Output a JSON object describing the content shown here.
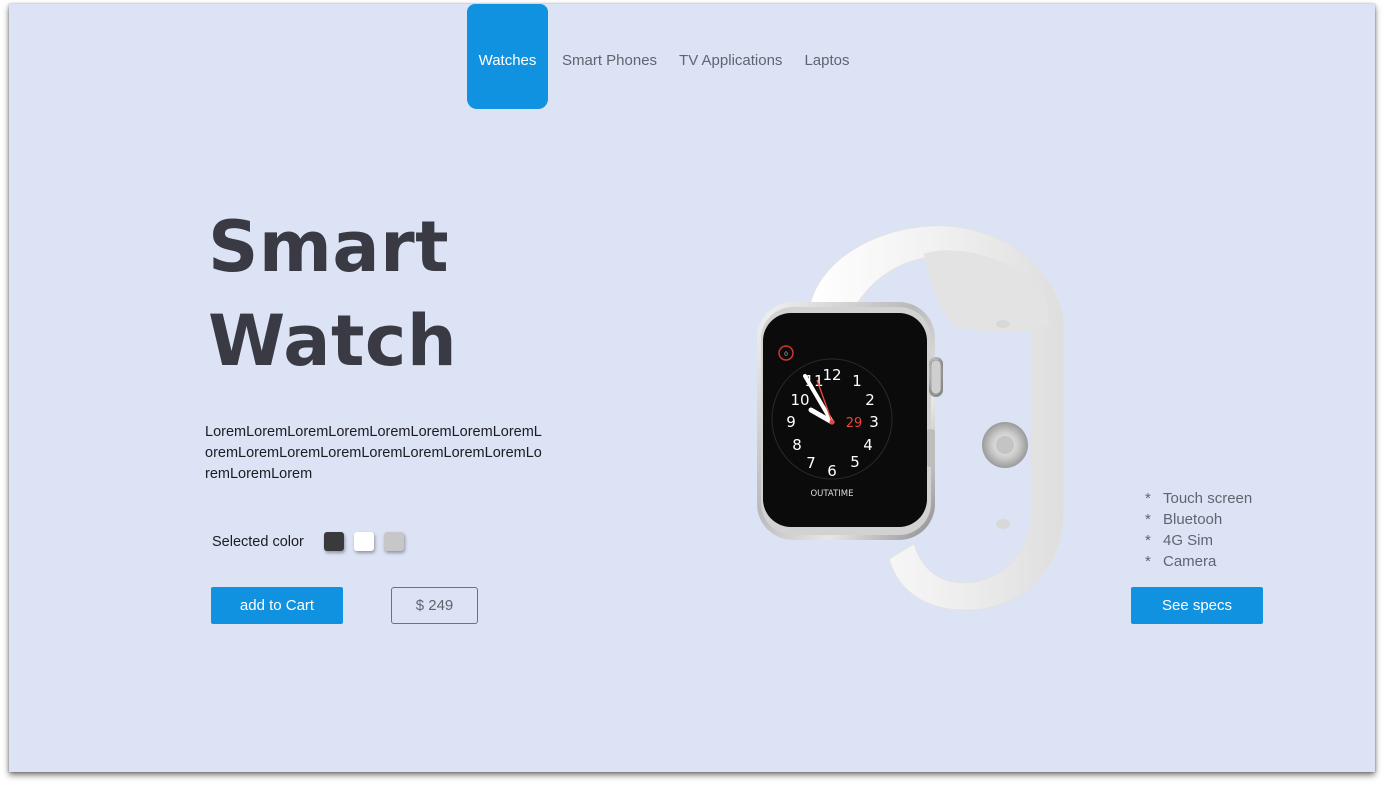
{
  "nav": {
    "tabs": [
      {
        "label": "Watches",
        "active": true
      },
      {
        "label": "Smart Phones",
        "active": false
      },
      {
        "label": "TV Applications",
        "active": false
      },
      {
        "label": "Laptos",
        "active": false
      }
    ]
  },
  "hero": {
    "title_line1": "Smart",
    "title_line2": "Watch",
    "description": "LoremLoremLoremLoremLoremLoremLoremLoremLoremLoremLoremLoremLoremLoremLoremLoremLoremLoremLorem"
  },
  "colors": {
    "label": "Selected color",
    "swatches": [
      {
        "name": "black",
        "hex": "#3a3a3d"
      },
      {
        "name": "white",
        "hex": "#ffffff"
      },
      {
        "name": "silver",
        "hex": "#c7c7c9"
      }
    ]
  },
  "actions": {
    "cart_label": "add to Cart",
    "price": "$ 249",
    "specs_label": "See specs"
  },
  "specs": {
    "bullet": "*",
    "items": [
      "Touch screen",
      "Bluetooh",
      "4G Sim",
      "Camera"
    ]
  },
  "watch_face": {
    "numbers": [
      "12",
      "1",
      "2",
      "3",
      "4",
      "5",
      "6",
      "7",
      "8",
      "9",
      "10",
      "11"
    ],
    "date": "29",
    "brand": "OUTATIME",
    "small_dial": "0"
  },
  "theme": {
    "accent": "#1192e0",
    "background": "#dce3f5",
    "heading": "#393a44"
  }
}
